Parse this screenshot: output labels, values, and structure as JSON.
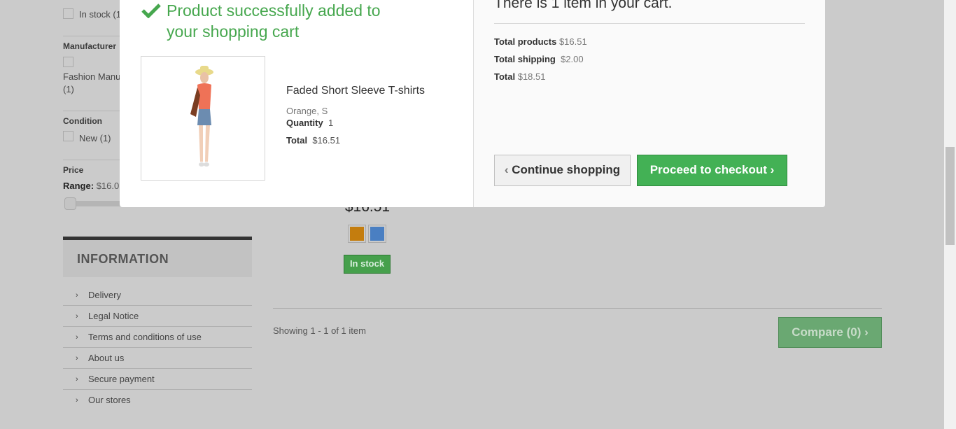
{
  "filters": {
    "in_stock": "In stock (1",
    "manufacturer_heading": "Manufacturer",
    "manufacturer_item": "Fashion Manu",
    "manufacturer_count": "(1)",
    "condition_heading": "Condition",
    "condition_item": "New (1)",
    "price_heading": "Price",
    "range_label": "Range:",
    "range_value": "$16.0"
  },
  "information": {
    "title": "INFORMATION",
    "items": [
      "Delivery",
      "Legal Notice",
      "Terms and conditions of use",
      "About us",
      "Secure payment",
      "Our stores"
    ]
  },
  "product": {
    "price": "$16.51",
    "colors": [
      "#c47d0e",
      "#4a7fc2"
    ],
    "stock": "In stock"
  },
  "listing": {
    "showing": "Showing 1 - 1 of 1 item",
    "compare": "Compare (0)"
  },
  "modal": {
    "success": "Product successfully added to",
    "success2": "your shopping cart",
    "name": "Faded Short Sleeve T-shirts",
    "attributes": "Orange, S",
    "quantity_label": "Quantity",
    "quantity": "1",
    "total_label": "Total",
    "total": "$16.51",
    "cart_title": "There is 1 item in your cart.",
    "total_products_label": "Total products",
    "total_products": "$16.51",
    "total_shipping_label": "Total shipping",
    "total_shipping": "$2.00",
    "grand_total_label": "Total",
    "grand_total": "$18.51",
    "continue": "Continue shopping",
    "checkout": "Proceed to checkout"
  }
}
